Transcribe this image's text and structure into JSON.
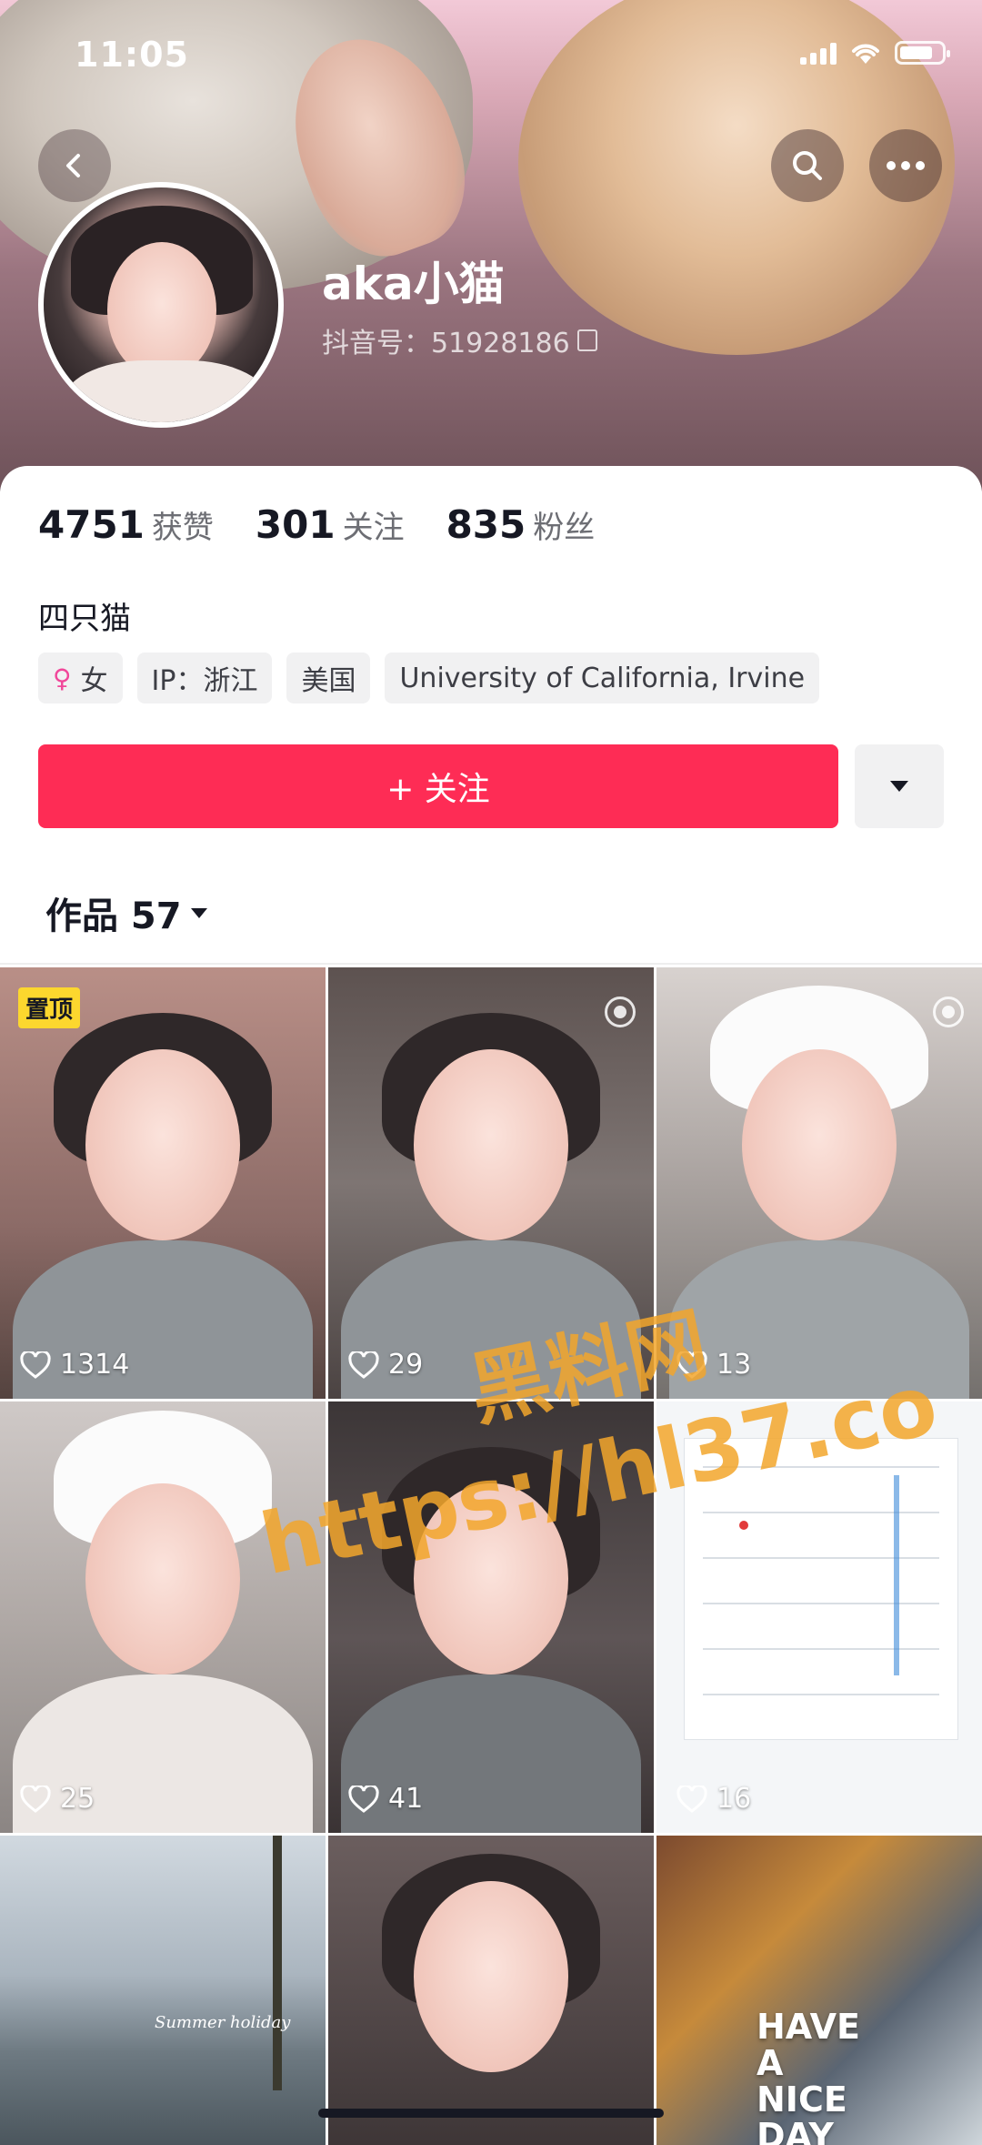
{
  "status": {
    "time": "11:05"
  },
  "profile": {
    "nickname": "aka小猫",
    "douyin_id": "抖音号：51928186",
    "stats": [
      {
        "value": "4751",
        "label": "获赞"
      },
      {
        "value": "301",
        "label": "关注"
      },
      {
        "value": "835",
        "label": "粉丝"
      }
    ],
    "bio": "四只猫",
    "tags": {
      "gender": "女",
      "ip": "IP：浙江",
      "country": "美国",
      "school": "University of California, Irvine"
    },
    "follow_label": "+ 关注"
  },
  "works": {
    "tab_label": "作品 57",
    "pinned_label": "置顶",
    "items": [
      {
        "likes": "1314"
      },
      {
        "likes": "29"
      },
      {
        "likes": "13"
      },
      {
        "likes": "25"
      },
      {
        "likes": "41"
      },
      {
        "likes": "16"
      },
      {
        "likes": ""
      },
      {
        "likes": ""
      },
      {
        "likes": ""
      }
    ],
    "overlay_texts": {
      "summer": "Summer holiday",
      "nice_day": "HAVE A NICE DAY"
    }
  },
  "watermark": {
    "line1": "黑料网",
    "line2": "https://hl37.co"
  },
  "colors": {
    "accent": "#fe2c55",
    "pin": "#fcd72e"
  },
  "icons": [
    "back-icon",
    "search-icon",
    "more-icon",
    "copy-icon",
    "female-icon",
    "triangle-down-icon",
    "heart-icon",
    "live-icon"
  ]
}
